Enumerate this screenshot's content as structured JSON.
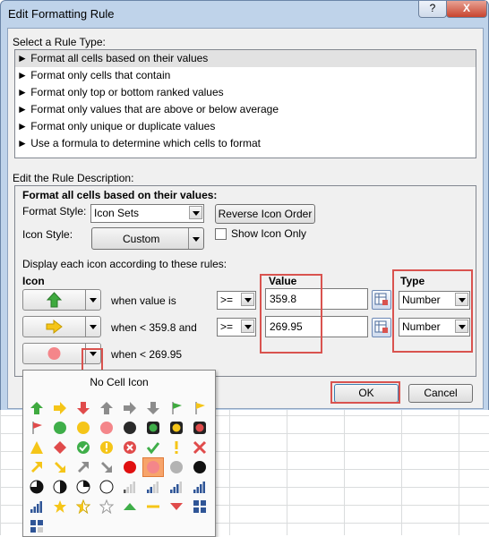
{
  "window": {
    "title": "Edit Formatting Rule",
    "help_label": "?",
    "close_label": "X"
  },
  "rule_type": {
    "heading": "Select a Rule Type:",
    "items": [
      "► Format all cells based on their values",
      "► Format only cells that contain",
      "► Format only top or bottom ranked values",
      "► Format only values that are above or below average",
      "► Format only unique or duplicate values",
      "► Use a formula to determine which cells to format"
    ],
    "selected_index": 0
  },
  "description": {
    "heading": "Edit the Rule Description:",
    "subheading": "Format all cells based on their values:",
    "format_style_label": "Format Style:",
    "format_style_value": "Icon Sets",
    "reverse_button": "Reverse Icon Order",
    "icon_style_label": "Icon Style:",
    "icon_style_value": "Custom",
    "show_icon_only_label": "Show Icon Only",
    "show_icon_only_checked": false,
    "display_rules_label": "Display each icon according to these rules:",
    "col_icon": "Icon",
    "col_value": "Value",
    "col_type": "Type"
  },
  "rules": [
    {
      "icon": "green-up-arrow",
      "condition": "when value is",
      "operator": ">=",
      "value": "359.8",
      "type": "Number"
    },
    {
      "icon": "yellow-right-arrow",
      "condition": "when < 359.8 and",
      "operator": ">=",
      "value": "269.95",
      "type": "Number"
    },
    {
      "icon": "light-red-circle",
      "condition": "when < 269.95"
    }
  ],
  "buttons": {
    "ok": "OK",
    "cancel": "Cancel"
  },
  "icon_picker": {
    "no_cell_icon": "No Cell Icon",
    "selected_icon": "light-red-circle"
  },
  "colors": {
    "highlight": "#d9534f",
    "selected_icon_bg": "#f7a46b",
    "window_frame": "#bfd3ea"
  }
}
